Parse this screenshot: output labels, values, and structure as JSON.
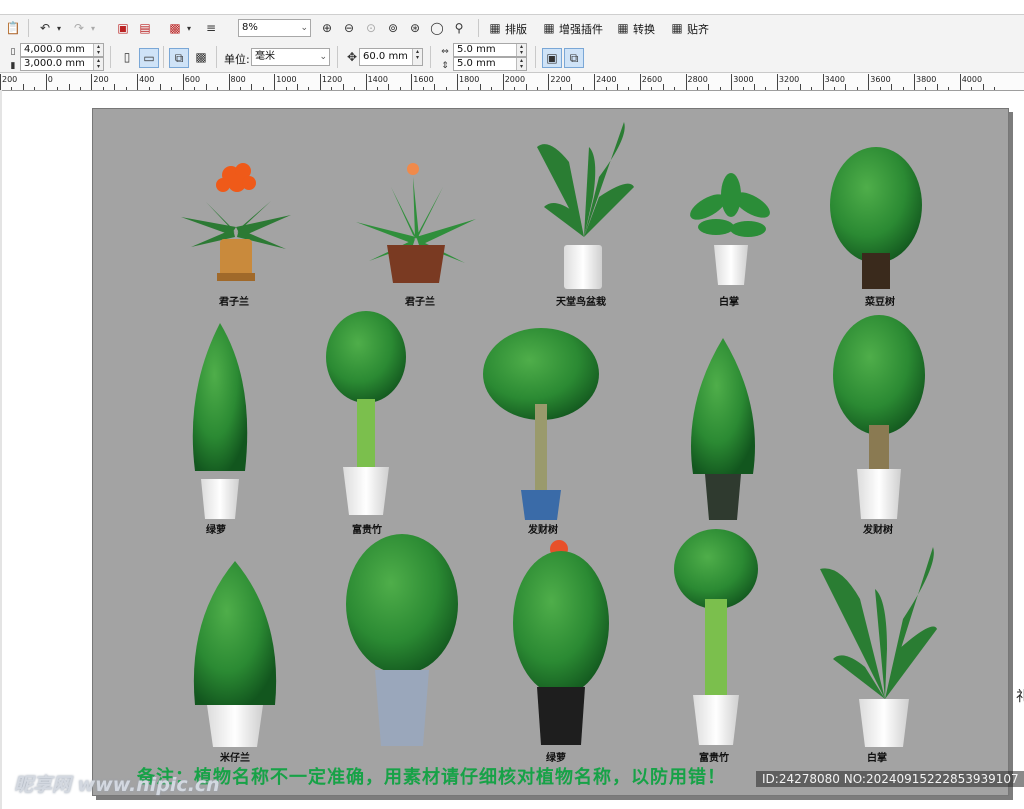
{
  "toolbar": {
    "zoom": "8%",
    "layout_label": "排版",
    "plugin_label": "增强插件",
    "convert_label": "转换",
    "snap_label": "贴齐"
  },
  "propbar": {
    "width": "4,000.0 mm",
    "height": "3,000.0 mm",
    "unit_label": "单位:",
    "unit_value": "毫米",
    "nudge": "60.0 mm",
    "dup_x": "5.0 mm",
    "dup_y": "5.0 mm"
  },
  "ruler": {
    "labels": [
      "200",
      "0",
      "200",
      "400",
      "600",
      "800",
      "1000",
      "1200",
      "1400",
      "1600",
      "1800",
      "2000",
      "2200",
      "2400",
      "2600",
      "2800",
      "3000",
      "3200",
      "3400",
      "3600",
      "3800",
      "4000"
    ]
  },
  "plants": [
    {
      "name": "君子兰"
    },
    {
      "name": "君子兰"
    },
    {
      "name": "天堂鸟盆栽"
    },
    {
      "name": "白掌"
    },
    {
      "name": "菜豆树"
    },
    {
      "name": "绿萝"
    },
    {
      "name": "富贵竹"
    },
    {
      "name": "发财树"
    },
    {
      "name": ""
    },
    {
      "name": "发财树"
    },
    {
      "name": "米仔兰"
    },
    {
      "name": ""
    },
    {
      "name": "绿萝"
    },
    {
      "name": "富贵竹"
    },
    {
      "name": "白掌"
    }
  ],
  "note": "备注：植物名称不一定准确，用素材请仔细核对植物名称，以防用错！",
  "watermark": {
    "site": "昵享网 www.nipic.cn",
    "id": "ID:24278080 NO:20240915222853939107"
  },
  "colors": {
    "canvas": "#a3a3a3",
    "note": "#17a247",
    "leaf": "#2e8b3a"
  }
}
